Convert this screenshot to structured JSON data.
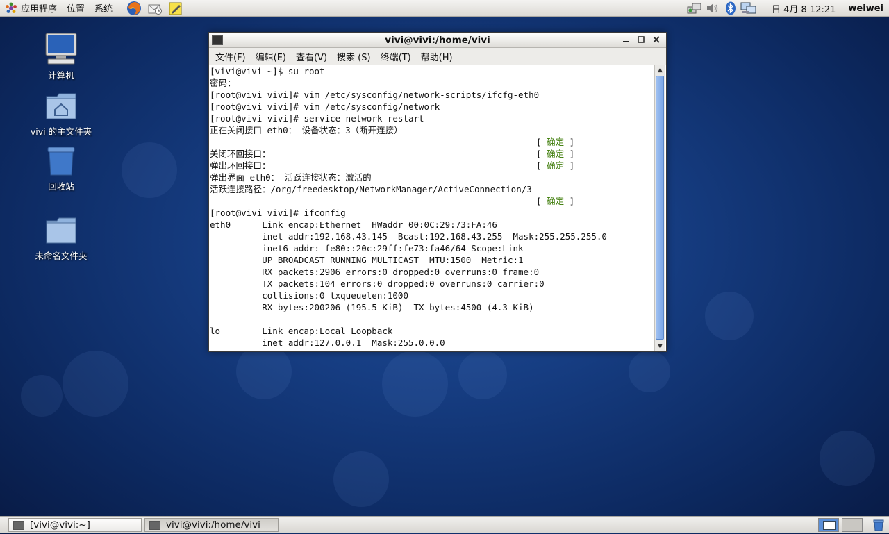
{
  "top_panel": {
    "applications": "应用程序",
    "places": "位置",
    "system": "系统",
    "launchers": [
      "firefox-icon",
      "mail-icon",
      "notes-icon"
    ],
    "tray_icons": [
      "network-icon",
      "volume-icon",
      "bluetooth-icon",
      "network-manager-icon"
    ],
    "clock": "日 4月  8 12:21",
    "user": "weiwei"
  },
  "desktop": {
    "icons": [
      {
        "label": "计算机",
        "icon": "computer-icon"
      },
      {
        "label": "vivi 的主文件夹",
        "icon": "home-folder-icon"
      },
      {
        "label": "回收站",
        "icon": "trash-icon"
      },
      {
        "label": "未命名文件夹",
        "icon": "folder-icon"
      }
    ]
  },
  "terminal": {
    "title": "vivi@vivi:/home/vivi",
    "menu": [
      "文件(F)",
      "编辑(E)",
      "查看(V)",
      "搜索 (S)",
      "终端(T)",
      "帮助(H)"
    ],
    "lines": [
      "[vivi@vivi ~]$ su root",
      "密码：",
      "[root@vivi vivi]# vim /etc/sysconfig/network-scripts/ifcfg-eth0",
      "[root@vivi vivi]# vim /etc/sysconfig/network",
      "[root@vivi vivi]# service network restart",
      "正在关闭接口 eth0： 设备状态：3（断开连接）",
      "",
      "关闭环回接口：",
      "弹出环回接口：",
      "弹出界面 eth0： 活跃连接状态：激活的",
      "活跃连接路径：/org/freedesktop/NetworkManager/ActiveConnection/3",
      "",
      "[root@vivi vivi]# ifconfig",
      "eth0      Link encap:Ethernet  HWaddr 00:0C:29:73:FA:46",
      "          inet addr:192.168.43.145  Bcast:192.168.43.255  Mask:255.255.255.0",
      "          inet6 addr: fe80::20c:29ff:fe73:fa46/64 Scope:Link",
      "          UP BROADCAST RUNNING MULTICAST  MTU:1500  Metric:1",
      "          RX packets:2906 errors:0 dropped:0 overruns:0 frame:0",
      "          TX packets:104 errors:0 dropped:0 overruns:0 carrier:0",
      "          collisions:0 txqueuelen:1000",
      "          RX bytes:200206 (195.5 KiB)  TX bytes:4500 (4.3 KiB)",
      "",
      "lo        Link encap:Local Loopback",
      "          inet addr:127.0.0.1  Mask:255.0.0.0"
    ],
    "ok_lines": [
      6,
      7,
      8,
      11
    ],
    "ok_text": "确定"
  },
  "taskbar": {
    "tasks": [
      {
        "label": "[vivi@vivi:~]",
        "active": false
      },
      {
        "label": "vivi@vivi:/home/vivi",
        "active": true
      }
    ]
  },
  "colors": {
    "ok_green": "#3f7d0a",
    "scroll_thumb": "#7aa6e8",
    "desktop_blue": "#163d82"
  }
}
